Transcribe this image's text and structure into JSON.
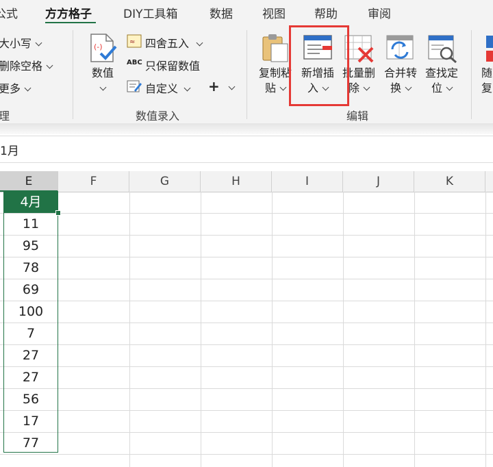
{
  "tabs": [
    {
      "label": "公式"
    },
    {
      "label": "方方格子"
    },
    {
      "label": "DIY工具箱"
    },
    {
      "label": "数据"
    },
    {
      "label": "视图"
    },
    {
      "label": "帮助"
    },
    {
      "label": "审阅"
    }
  ],
  "ribbon": {
    "left_group": {
      "items": [
        "大小写",
        "删除空格",
        "更多"
      ],
      "label": "理"
    },
    "numeric_group": {
      "value_button": "数值",
      "round_button": "四舍五入",
      "keep_numbers_button": "只保留数值",
      "custom_button": "自定义",
      "plus_button": "+",
      "label": "数值录入"
    },
    "edit_group": {
      "copy_paste": [
        "复制粘",
        "贴"
      ],
      "insert": [
        "新增插",
        "入"
      ],
      "batch_delete": [
        "批量删",
        "除"
      ],
      "merge_convert": [
        "合并转",
        "换"
      ],
      "find_locate": [
        "查找定",
        "位"
      ],
      "random": [
        "随",
        "复"
      ],
      "label": "编辑"
    }
  },
  "formula_bar": {
    "value": "1月"
  },
  "columns": [
    "E",
    "F",
    "G",
    "H",
    "I",
    "J",
    "K"
  ],
  "sheet": {
    "header_cell": "4月",
    "values": [
      "11",
      "95",
      "78",
      "69",
      "100",
      "7",
      "27",
      "27",
      "56",
      "17",
      "77"
    ]
  },
  "colors": {
    "accent": "#217346",
    "highlight": "#e53935"
  }
}
